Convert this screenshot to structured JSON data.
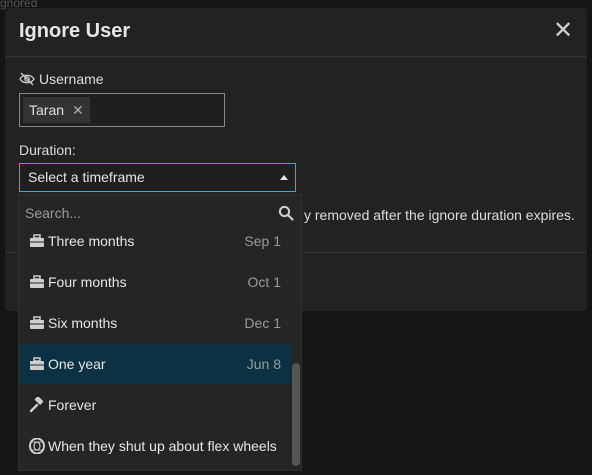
{
  "background": {
    "partial_text": "gnored"
  },
  "modal": {
    "title": "Ignore User",
    "close_glyph": "✕",
    "username_label": "Username",
    "username_chip": "Taran",
    "chip_remove_glyph": "✕",
    "duration_label": "Duration:",
    "select_value": "Select a timeframe",
    "info_text": "y removed after the ignore duration expires."
  },
  "dropdown": {
    "search_placeholder": "Search...",
    "options": [
      {
        "label": "Three months",
        "date": "Sep 1",
        "icon": "briefcase-icon"
      },
      {
        "label": "Four months",
        "date": "Oct 1",
        "icon": "briefcase-icon"
      },
      {
        "label": "Six months",
        "date": "Dec 1",
        "icon": "briefcase-icon"
      },
      {
        "label": "One year",
        "date": "Jun 8",
        "icon": "briefcase-icon"
      },
      {
        "label": "Forever",
        "date": "",
        "icon": "gavel-icon"
      },
      {
        "label": "When they shut up about flex wheels",
        "date": "",
        "icon": "tire-icon"
      }
    ],
    "highlighted_index": 3
  },
  "colors": {
    "accent": "#3ba9d6",
    "highlight": "#0b3242",
    "modal_bg": "#222222"
  }
}
